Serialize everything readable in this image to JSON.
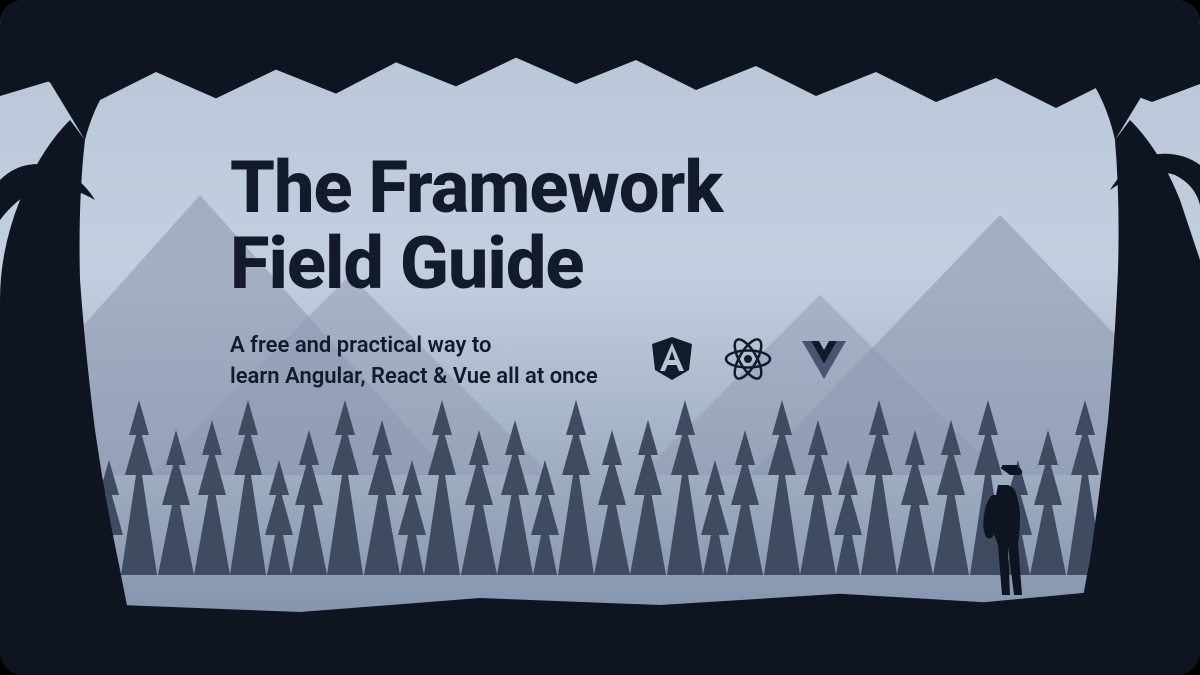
{
  "hero": {
    "title_line1": "The Framework",
    "title_line2": "Field Guide",
    "subtitle_line1": "A free and practical way to",
    "subtitle_line2": "learn Angular, React & Vue all at once"
  },
  "frameworks": [
    {
      "name": "Angular",
      "icon": "angular-icon"
    },
    {
      "name": "React",
      "icon": "react-icon"
    },
    {
      "name": "Vue",
      "icon": "vue-icon"
    }
  ],
  "colors": {
    "text": "#131b2a",
    "foreground": "#0e1420",
    "sky": "#b8c5d6",
    "forest": "#3f4b61",
    "mountains": "#8d9ab2"
  }
}
